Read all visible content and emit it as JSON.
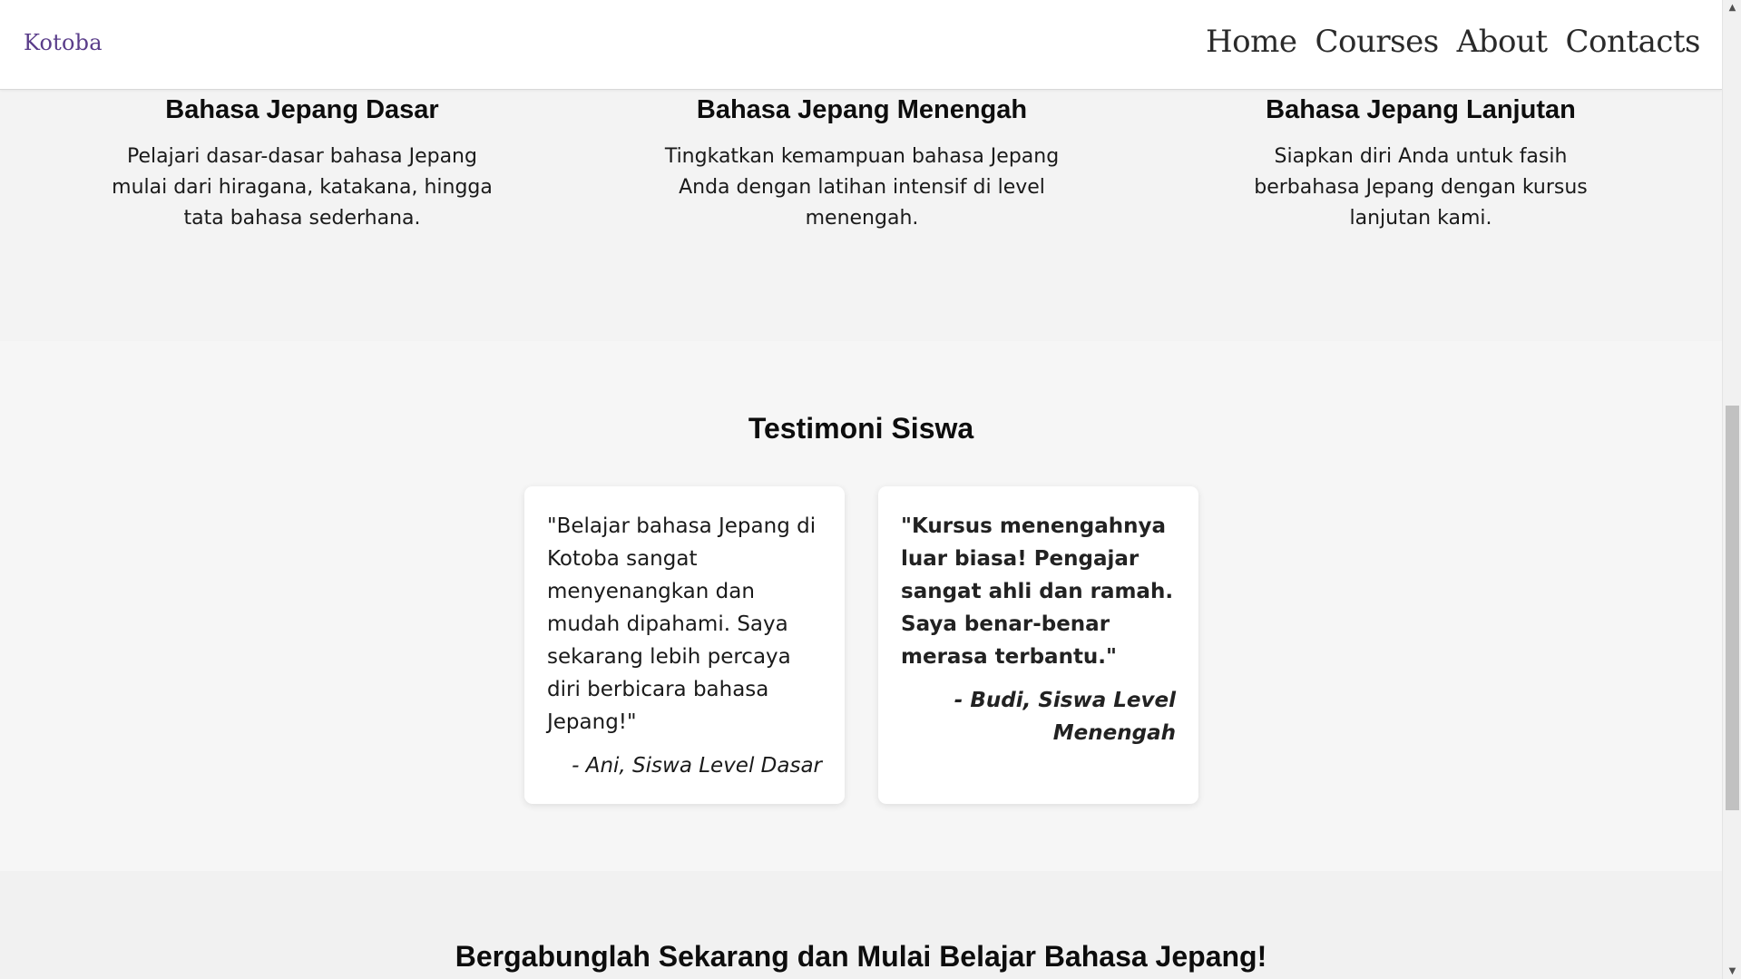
{
  "brand": {
    "name": "Kotoba"
  },
  "nav": {
    "items": [
      "Home",
      "Courses",
      "About",
      "Contacts"
    ]
  },
  "courses": [
    {
      "title": "Bahasa Jepang Dasar",
      "desc": "Pelajari dasar-dasar bahasa Jepang mulai dari hiragana, katakana, hingga tata bahasa sederhana."
    },
    {
      "title": "Bahasa Jepang Menengah",
      "desc": "Tingkatkan kemampuan bahasa Jepang Anda dengan latihan intensif di level menengah."
    },
    {
      "title": "Bahasa Jepang Lanjutan",
      "desc": "Siapkan diri Anda untuk fasih berbahasa Jepang dengan kursus lanjutan kami."
    }
  ],
  "testimonials": {
    "title": "Testimoni Siswa",
    "items": [
      {
        "quote": "\"Belajar bahasa Jepang di Kotoba sangat menyenangkan dan mudah dipahami. Saya sekarang lebih percaya diri berbicara bahasa Jepang!\"",
        "author": "- Ani, Siswa Level Dasar"
      },
      {
        "quote": "\"Kursus menengahnya luar biasa! Pengajar sangat ahli dan ramah. Saya benar-benar merasa terbantu.\"",
        "author": "- Budi, Siswa Level Menengah"
      }
    ]
  },
  "join": {
    "title": "Bergabunglah Sekarang dan Mulai Belajar Bahasa Jepang!"
  },
  "colors": {
    "brand": "#5a3d8a",
    "background": "#f5f5f5",
    "card": "#ffffff"
  }
}
